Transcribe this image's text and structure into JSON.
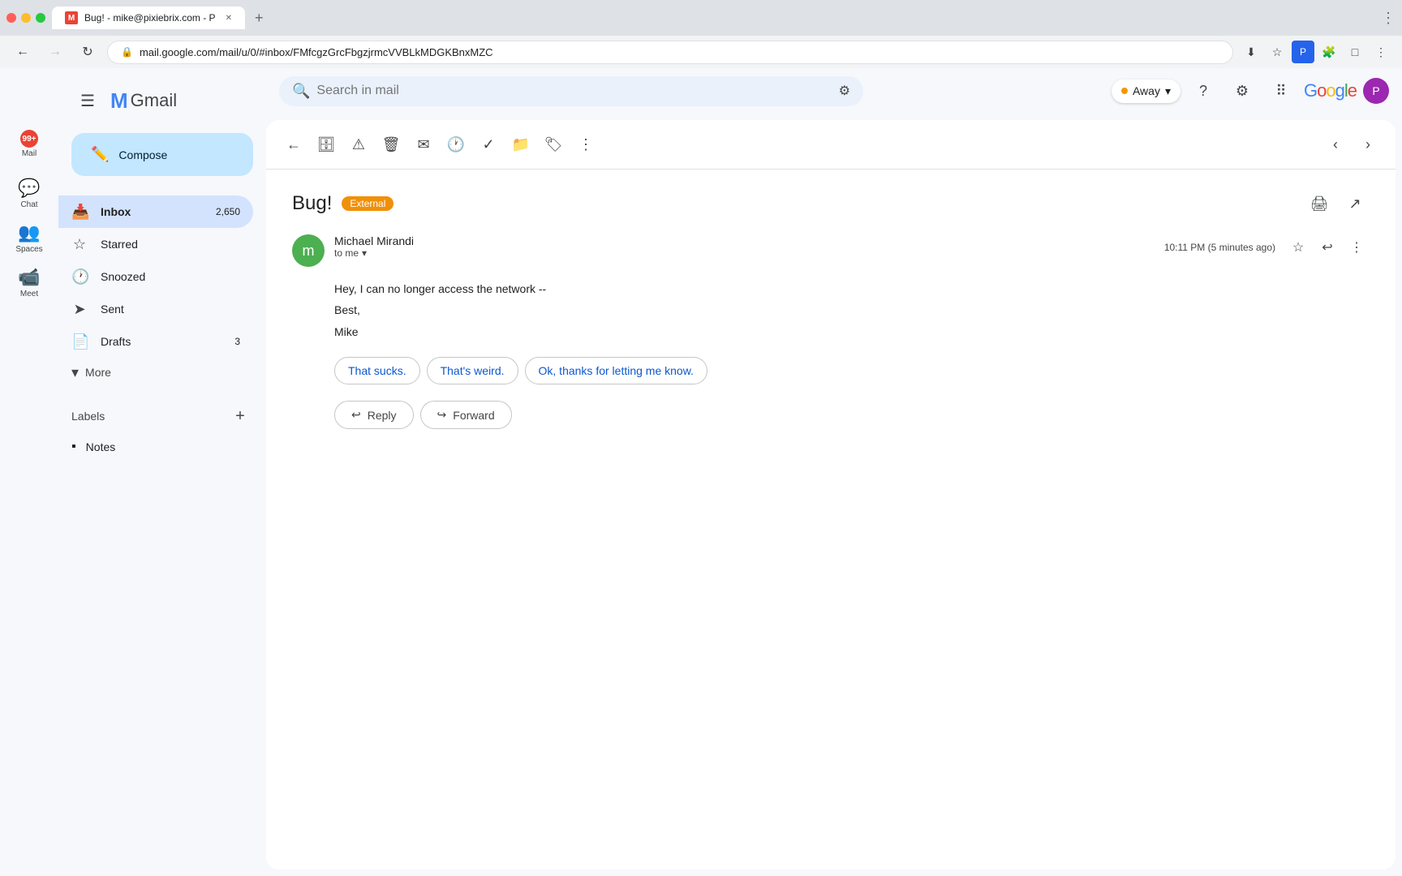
{
  "browser": {
    "tab_title": "Bug! - mike@pixiebrix.com - P",
    "url": "mail.google.com/mail/u/0/#inbox/FMfcgzGrcFbgzjrmcVVBLkMDGKBnxMZC",
    "back_disabled": false,
    "forward_disabled": false
  },
  "topbar": {
    "search_placeholder": "Search in mail",
    "away_label": "Away",
    "google_text": "Google",
    "profile_initial": "P"
  },
  "sidebar": {
    "compose_label": "Compose",
    "inbox_label": "Inbox",
    "inbox_count": "2,650",
    "starred_label": "Starred",
    "snoozed_label": "Snoozed",
    "sent_label": "Sent",
    "drafts_label": "Drafts",
    "drafts_count": "3",
    "more_label": "More",
    "labels_title": "Labels",
    "notes_label": "Notes",
    "mail_label": "Mail",
    "chat_label": "Chat",
    "spaces_label": "Spaces",
    "meet_label": "Meet"
  },
  "email": {
    "subject": "Bug!",
    "external_badge": "External",
    "sender_name": "Michael Mirandi",
    "sender_initial": "m",
    "to_label": "to me",
    "timestamp": "10:11 PM (5 minutes ago)",
    "body_line1": "Hey, I can no longer access the network --",
    "body_line2": "Best,",
    "body_line3": "Mike",
    "smart_replies": [
      "That sucks.",
      "That's weird.",
      "Ok, thanks for letting me know."
    ],
    "reply_btn": "Reply",
    "forward_btn": "Forward"
  }
}
